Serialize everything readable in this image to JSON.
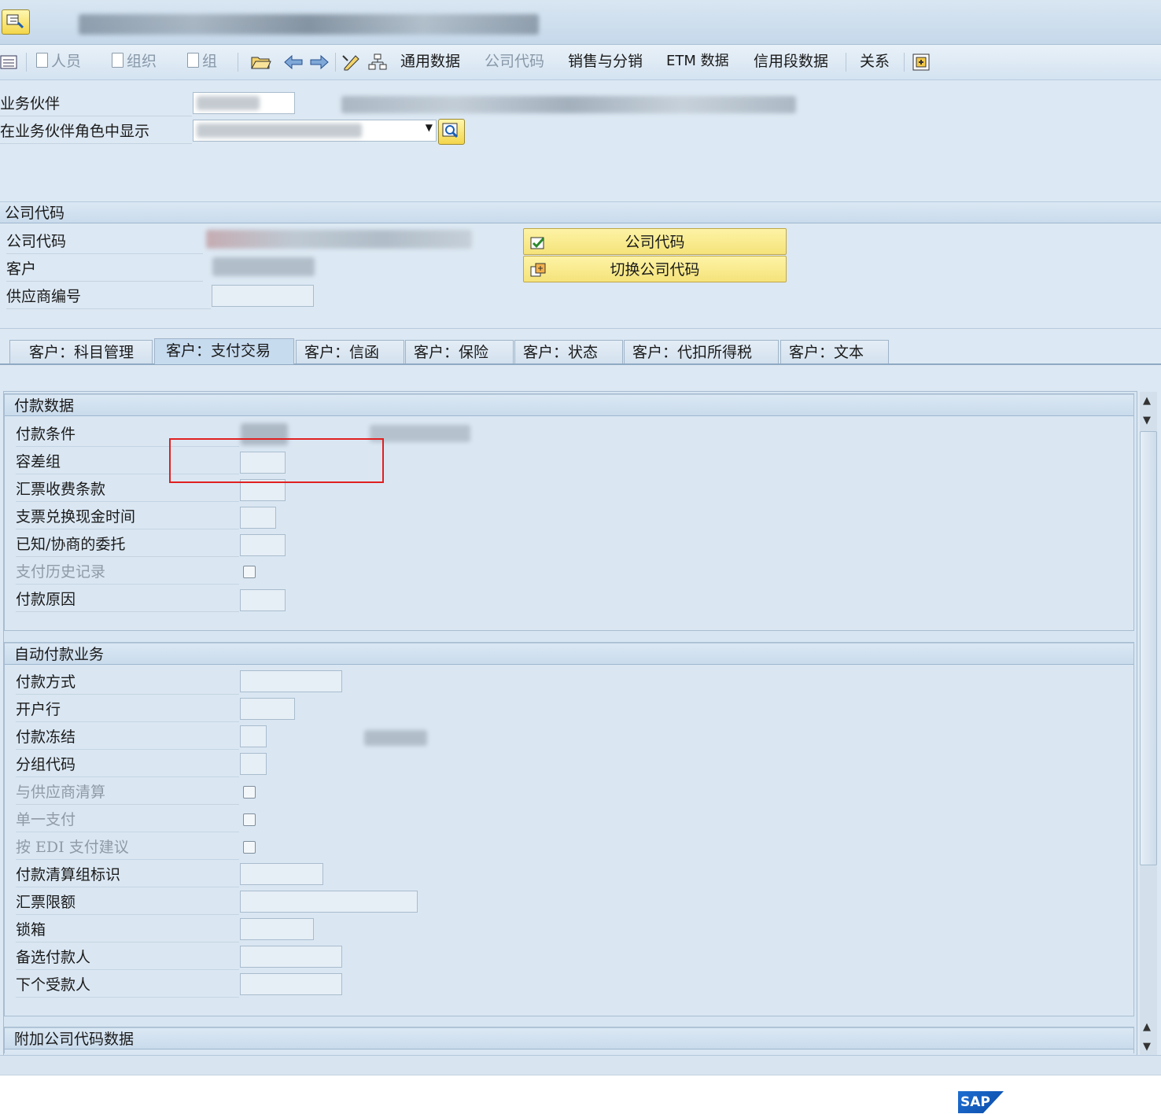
{
  "toolbar": {
    "person": "人员",
    "organization": "组织",
    "group": "组",
    "general_data": "通用数据",
    "company_code": "公司代码",
    "sales_distribution": "销售与分销",
    "etm_data": "ETM 数据",
    "credit_segment_data": "信用段数据",
    "relationships": "关系"
  },
  "header": {
    "business_partner_label": "业务伙伴",
    "display_in_role_label": "在业务伙伴角色中显示"
  },
  "company_section": {
    "title": "公司代码",
    "company_code_label": "公司代码",
    "customer_label": "客户",
    "vendor_number_label": "供应商编号",
    "company_code_button": "公司代码",
    "switch_company_code_button": "切换公司代码"
  },
  "tabs": [
    {
      "label": "客户：科目管理",
      "active": false
    },
    {
      "label": "客户：支付交易",
      "active": true
    },
    {
      "label": "客户：信函",
      "active": false
    },
    {
      "label": "客户：保险",
      "active": false
    },
    {
      "label": "客户：状态",
      "active": false
    },
    {
      "label": "客户：代扣所得税",
      "active": false
    },
    {
      "label": "客户：文本",
      "active": false
    }
  ],
  "payment_data": {
    "title": "付款数据",
    "fields": [
      {
        "label": "付款条件"
      },
      {
        "label": "容差组"
      },
      {
        "label": "汇票收费条款"
      },
      {
        "label": "支票兑换现金时间"
      },
      {
        "label": "已知/协商的委托"
      },
      {
        "label": "支付历史记录"
      },
      {
        "label": "付款原因"
      }
    ]
  },
  "auto_payment": {
    "title": "自动付款业务",
    "fields": [
      {
        "label": "付款方式"
      },
      {
        "label": "开户行"
      },
      {
        "label": "付款冻结"
      },
      {
        "label": "分组代码"
      },
      {
        "label": "与供应商清算"
      },
      {
        "label": "单一支付"
      },
      {
        "label": "按 EDI 支付建议"
      },
      {
        "label": "付款清算组标识"
      },
      {
        "label": "汇票限额"
      },
      {
        "label": "锁箱"
      },
      {
        "label": "备选付款人"
      },
      {
        "label": "下个受款人"
      }
    ]
  },
  "additional_section": {
    "title": "附加公司代码数据"
  },
  "footer": {
    "logo_text": "SAP"
  },
  "colors": {
    "background": "#dce8f3",
    "button_yellow": "#f5e37a",
    "highlight_red": "#e02020",
    "sap_blue": "#1e6ed1"
  }
}
